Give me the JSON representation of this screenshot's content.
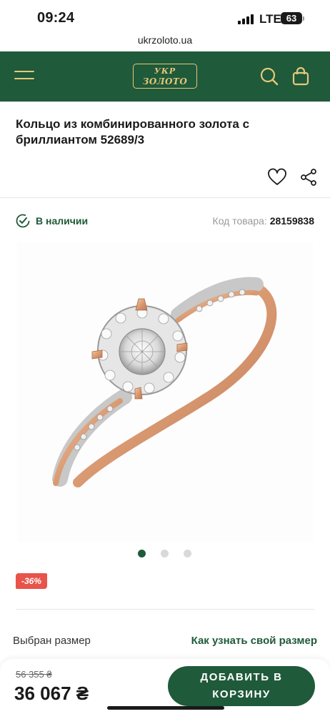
{
  "status_bar": {
    "time": "09:24",
    "network": "LTE",
    "battery": "63"
  },
  "browser": {
    "url": "ukrzoloto.ua"
  },
  "header": {
    "logo_line1": "УКР",
    "logo_line2": "ЗОЛОТО",
    "menu_icon": "hamburger-icon",
    "search_icon": "search-icon",
    "bag_icon": "shopping-bag-icon"
  },
  "product": {
    "title": "Кольцо из комбинированного золота с бриллиантом 52689/3",
    "availability": "В наличии",
    "sku_label": "Код товара:",
    "sku_value": "28159838",
    "discount": "-36%",
    "gallery": {
      "total": 3,
      "active": 1
    }
  },
  "size": {
    "selected_label": "Выбран размер",
    "guide_link": "Как узнать свой размер"
  },
  "purchase": {
    "old_price": "56 355 ₴",
    "price": "36 067 ₴",
    "add_to_cart_line1": "ДОБАВИТЬ В",
    "add_to_cart_line2": "КОРЗИНУ"
  },
  "colors": {
    "brand_green": "#1f5a3a",
    "gold": "#e6c87a",
    "discount_red": "#e8534a"
  }
}
